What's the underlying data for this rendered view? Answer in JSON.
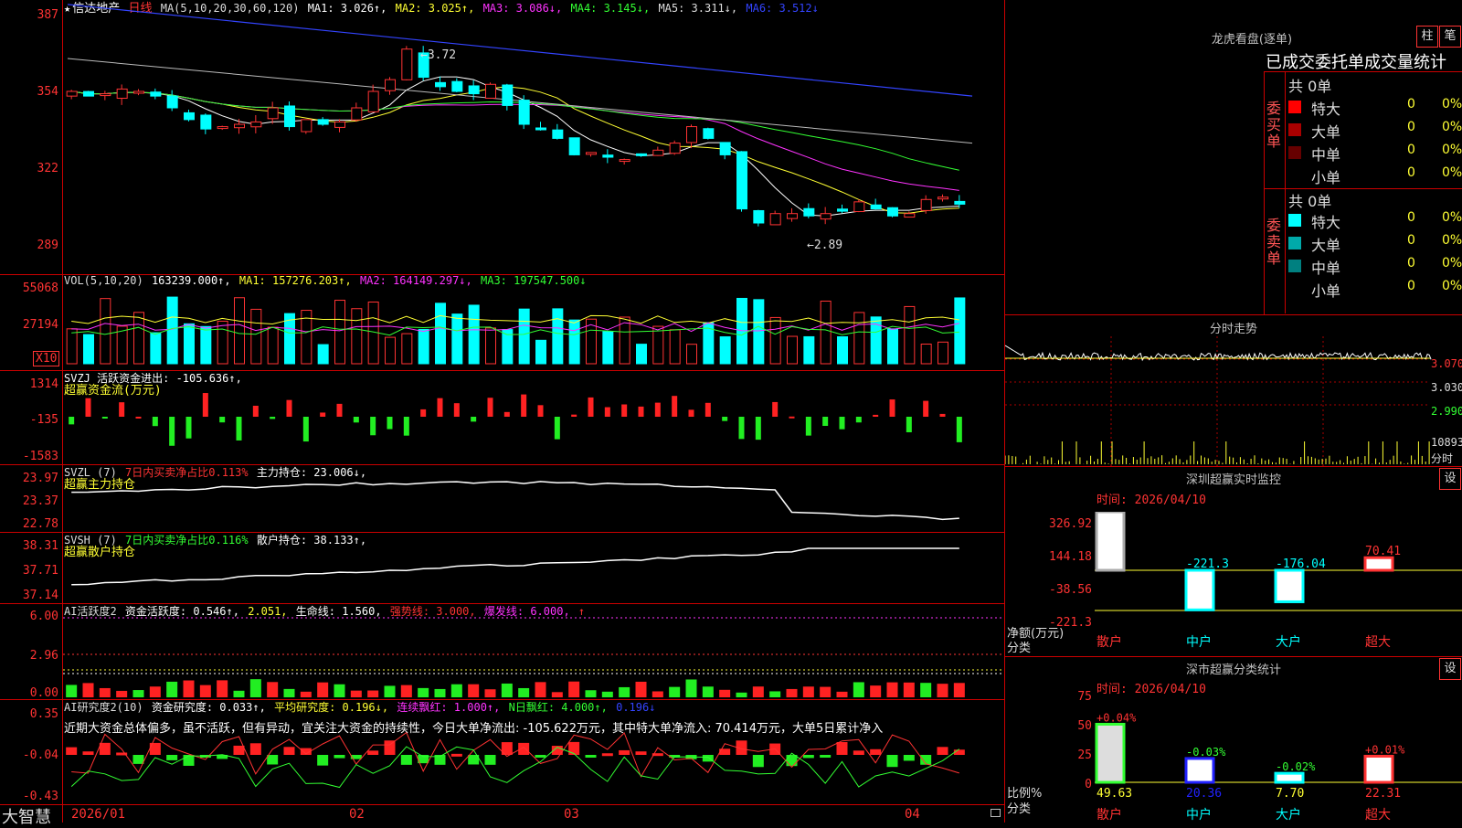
{
  "stock": {
    "name_star": "★",
    "name": "信达地产",
    "period": "日线"
  },
  "ma_legend": {
    "prefix": "MA(5,10,20,30,60,120)",
    "ma1": "MA1: 3.026↑,",
    "ma2": "MA2: 3.025↑,",
    "ma3": "MA3: 3.086↓,",
    "ma4": "MA4: 3.145↓,",
    "ma5": "MA5: 3.311↓,",
    "ma6": "MA6: 3.512↓"
  },
  "price_axis": [
    "387",
    "354",
    "322",
    "289"
  ],
  "price_marks": {
    "high": "←3.72",
    "low": "←2.89"
  },
  "vol_legend": {
    "prefix": "VOL(5,10,20)",
    "value": "163239.000↑,",
    "ma1": "MA1: 157276.203↑,",
    "ma2": "MA2: 164149.297↓,",
    "ma3": "MA3: 197547.500↓"
  },
  "vol_axis": [
    "55068",
    "27194"
  ],
  "vol_unit": "X10",
  "svzj_legend": {
    "line1": "SVZJ  活跃资金进出: -105.636↑,",
    "line2": "超赢资金流(万元)"
  },
  "svzj_axis": [
    "1314",
    "-135",
    "-1583"
  ],
  "svzl_legend": {
    "prefix": "SVZL (7)",
    "ratio": "7日内买卖净占比0.113%",
    "hold": "主力持仓: 23.006↓,",
    "line2": "超赢主力持仓"
  },
  "svzl_axis": [
    "23.97",
    "23.37",
    "22.78"
  ],
  "svsh_legend": {
    "prefix": "SVSH (7)",
    "ratio": "7日内买卖净占比0.116%",
    "hold": "散户持仓: 38.133↑,",
    "line2": "超赢散户持仓"
  },
  "svsh_axis": [
    "38.31",
    "37.71",
    "37.14"
  ],
  "ai_act_legend": {
    "prefix": "AI活跃度2",
    "a": "资金活跃度: 0.546↑,",
    "b": "2.051,",
    "c": "生命线: 1.560,",
    "d": "强势线: 3.000,",
    "e": "爆发线: 6.000,",
    "f": "↑"
  },
  "ai_act_axis": [
    "6.00",
    "2.96",
    "0.00"
  ],
  "ai_res_legend": {
    "prefix": "AI研究度2(10)",
    "a": "资金研究度: 0.033↑,",
    "b": "平均研究度: 0.196↓,",
    "c": "连续飘红: 1.000↑,",
    "d": "N日飘红: 4.000↑,",
    "e": "0.196↓"
  },
  "ai_res_text": "近期大资金总体偏多，虽不活跃，但有异动，宜关注大资金的持续性，今日大单净流出: -105.622万元，其中特大单净流入: 70.414万元，大单5日累计净入",
  "ai_res_axis": [
    "0.35",
    "-0.04",
    "-0.43"
  ],
  "date_axis": [
    "2026/01",
    "02",
    "03",
    "04"
  ],
  "brand": "大智慧",
  "right": {
    "lhb_title": "龙虎看盘(逐单)",
    "btn_zhu": "柱",
    "btn_bi": "笔",
    "tabs": "已成交委托单成交量统计",
    "buy": {
      "label": "委买单",
      "total": "共 0单",
      "rows": [
        {
          "name": "特大",
          "n": "0",
          "p": "0%"
        },
        {
          "name": "大单",
          "n": "0",
          "p": "0%"
        },
        {
          "name": "中单",
          "n": "0",
          "p": "0%"
        },
        {
          "name": "小单",
          "n": "0",
          "p": "0%"
        }
      ]
    },
    "sell": {
      "label": "委卖单",
      "total": "共 0单",
      "rows": [
        {
          "name": "特大",
          "n": "0",
          "p": "0%"
        },
        {
          "name": "大单",
          "n": "0",
          "p": "0%"
        },
        {
          "name": "中单",
          "n": "0",
          "p": "0%"
        },
        {
          "name": "小单",
          "n": "0",
          "p": "0%"
        }
      ]
    },
    "intraday_title": "分时走势",
    "intraday_axis": [
      "3.070",
      "3.030",
      "2.990",
      "10893",
      "分时"
    ],
    "sz_monitor": {
      "title": "深圳超赢实时监控",
      "btn": "设",
      "time": "时间: 2026/04/10",
      "axis": [
        "326.92",
        "144.18",
        "-38.56",
        "-221.3"
      ],
      "ylabel1": "净额(万元)",
      "ylabel2": "分类",
      "categories": [
        "散户",
        "中户",
        "大户",
        "超大"
      ],
      "values": [
        326.92,
        -221.3,
        -176.04,
        70.41
      ],
      "value_labels": [
        "326.92",
        "-221.3",
        "-176.04",
        "70.41"
      ]
    },
    "sz_class": {
      "title": "深市超赢分类统计",
      "btn": "设",
      "time": "时间: 2026/04/10",
      "axis": [
        "75",
        "50",
        "25",
        "0"
      ],
      "ylabel1": "比例%",
      "ylabel2": "分类",
      "categories": [
        "散户",
        "中户",
        "大户",
        "超大"
      ],
      "values": [
        49.63,
        20.36,
        7.7,
        22.31
      ],
      "value_labels": [
        "49.63",
        "20.36",
        "7.70",
        "22.31"
      ],
      "changes": [
        "+0.04%",
        "-0.03%",
        "-0.02%",
        "+0.01%"
      ]
    }
  },
  "chart_data": [
    {
      "type": "candlestick",
      "title": "信达地产 日线",
      "ylim": [
        2.89,
        3.87
      ],
      "x": [
        "2026/01",
        "02",
        "03",
        "04"
      ],
      "ohlc_close": [
        3.52,
        3.5,
        3.51,
        3.53,
        3.52,
        3.5,
        3.45,
        3.4,
        3.36,
        3.37,
        3.38,
        3.39,
        3.45,
        3.37,
        3.4,
        3.38,
        3.39,
        3.45,
        3.52,
        3.57,
        3.7,
        3.58,
        3.54,
        3.52,
        3.51,
        3.55,
        3.46,
        3.38,
        3.36,
        3.32,
        3.25,
        3.26,
        3.24,
        3.23,
        3.25,
        3.27,
        3.3,
        3.37,
        3.32,
        3.25,
        3.02,
        2.96,
        3.0,
        3.0,
        2.99,
        3.0,
        3.01,
        3.05,
        3.02,
        2.99,
        3.0,
        3.06,
        3.07,
        3.04
      ],
      "highlights": {
        "high": 3.72,
        "low": 2.89
      }
    },
    {
      "type": "bar",
      "title": "VOL(5,10,20)",
      "ylim": [
        0,
        55068
      ]
    },
    {
      "type": "bar",
      "title": "超赢资金流(万元)",
      "ylim": [
        -1583,
        1314
      ]
    },
    {
      "type": "line",
      "title": "超赢主力持仓",
      "ylim": [
        22.78,
        23.97
      ]
    },
    {
      "type": "line",
      "title": "超赢散户持仓",
      "ylim": [
        37.14,
        38.31
      ]
    },
    {
      "type": "bar",
      "title": "AI活跃度2",
      "ylim": [
        0,
        6.0
      ]
    },
    {
      "type": "bar",
      "title": "AI研究度2(10)",
      "ylim": [
        -0.43,
        0.35
      ]
    }
  ]
}
